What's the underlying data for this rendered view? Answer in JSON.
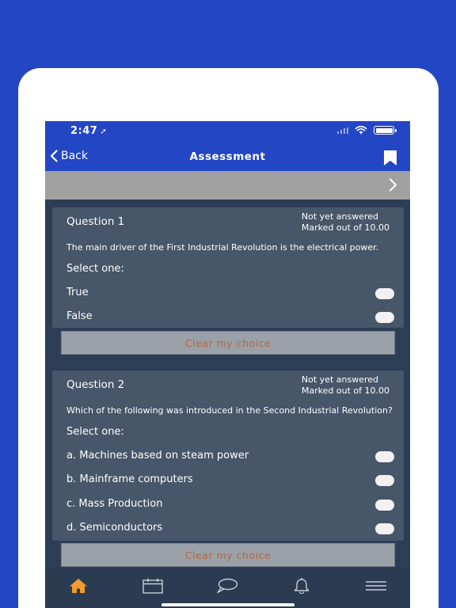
{
  "status_bar": {
    "time": "2:47"
  },
  "header": {
    "back_label": "Back",
    "title": "Assessment"
  },
  "questions": [
    {
      "title": "Question 1",
      "state": "Not yet answered",
      "marks": "Marked out of 10.00",
      "text": "The main driver of the First Industrial Revolution is the electrical power.",
      "prompt": "Select one:",
      "options": [
        "True",
        "False"
      ],
      "clear_label": "Clear my choice"
    },
    {
      "title": "Question 2",
      "state": "Not yet answered",
      "marks": "Marked out of 10.00",
      "text": "Which of the following was introduced in the Second Industrial Revolution?",
      "prompt": "Select one:",
      "options": [
        "a. Machines based on steam power",
        "b. Mainframe computers",
        "c. Mass Production",
        "d. Semiconductors"
      ],
      "clear_label": "Clear my choice"
    }
  ],
  "tab_bar": {
    "icons": [
      "home-icon",
      "calendar-icon",
      "chat-icon",
      "bell-icon",
      "menu-icon"
    ],
    "active_color": "#f39a2c",
    "inactive_color": "#c7ced8"
  },
  "colors": {
    "brand": "#2346c4",
    "card": "#475669",
    "screen": "#2c3e55",
    "clear_text": "#b6673d"
  }
}
